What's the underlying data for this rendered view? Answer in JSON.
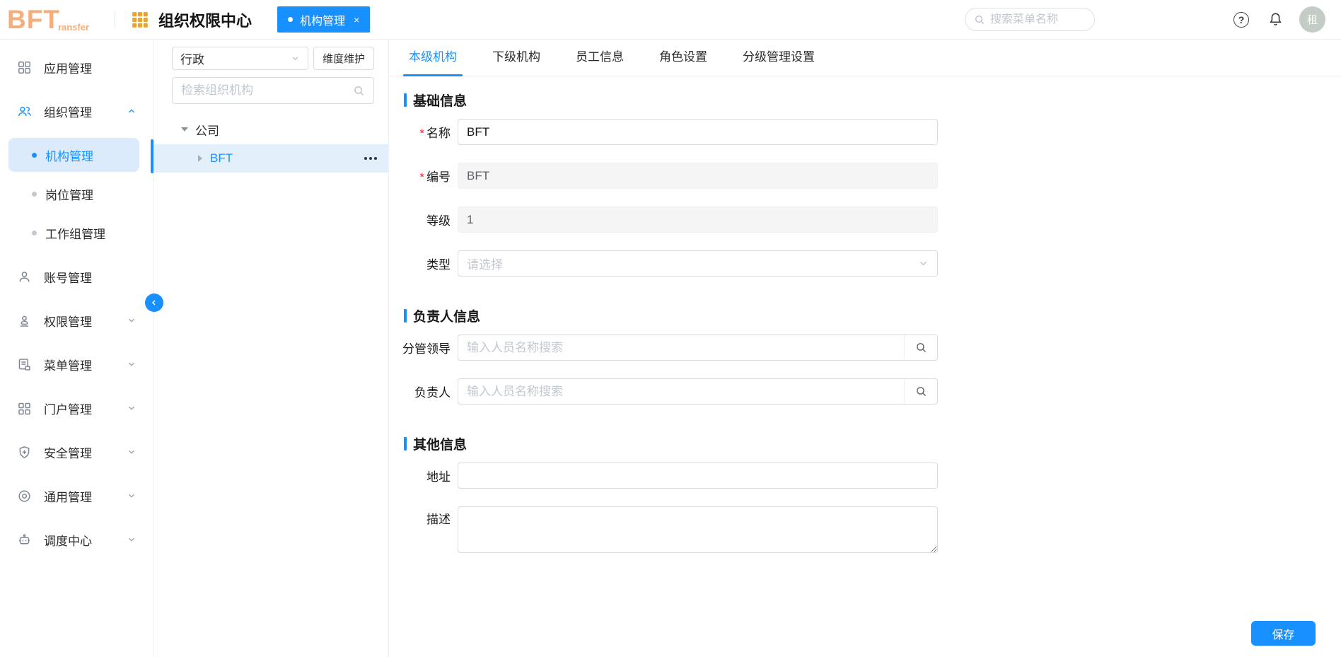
{
  "header": {
    "logo_main": "BFT",
    "logo_sub": "ransfer",
    "app_title": "组织权限中心",
    "chip": {
      "label": "机构管理",
      "close": "×"
    },
    "search_placeholder": "搜索菜单名称",
    "avatar_text": "租"
  },
  "sidebar": {
    "items": [
      {
        "label": "应用管理",
        "icon": "apps-icon"
      },
      {
        "label": "组织管理",
        "icon": "team-icon",
        "expanded": true,
        "children": [
          {
            "label": "机构管理",
            "active": true
          },
          {
            "label": "岗位管理"
          },
          {
            "label": "工作组管理"
          }
        ]
      },
      {
        "label": "账号管理",
        "icon": "user-icon"
      },
      {
        "label": "权限管理",
        "icon": "permission-icon"
      },
      {
        "label": "菜单管理",
        "icon": "menu-doc-icon"
      },
      {
        "label": "门户管理",
        "icon": "portal-icon"
      },
      {
        "label": "安全管理",
        "icon": "shield-icon"
      },
      {
        "label": "通用管理",
        "icon": "general-icon"
      },
      {
        "label": "调度中心",
        "icon": "robot-icon"
      }
    ]
  },
  "tree_panel": {
    "dimension_value": "行政",
    "maintain_button": "维度维护",
    "search_placeholder": "检索组织机构",
    "root_node": "公司",
    "child_node": "BFT"
  },
  "main": {
    "tabs": [
      {
        "label": "本级机构",
        "active": true
      },
      {
        "label": "下级机构"
      },
      {
        "label": "员工信息"
      },
      {
        "label": "角色设置"
      },
      {
        "label": "分级管理设置"
      }
    ],
    "required_mark": "*",
    "sections": {
      "basic": {
        "title": "基础信息"
      },
      "leader": {
        "title": "负责人信息"
      },
      "other": {
        "title": "其他信息"
      }
    },
    "form": {
      "name": {
        "label": "名称",
        "value": "BFT"
      },
      "code": {
        "label": "编号",
        "value": "BFT"
      },
      "level": {
        "label": "等级",
        "value": "1"
      },
      "type": {
        "label": "类型",
        "placeholder": "请选择"
      },
      "leader": {
        "label": "分管领导",
        "placeholder": "输入人员名称搜索",
        "value": ""
      },
      "manager": {
        "label": "负责人",
        "placeholder": "输入人员名称搜索",
        "value": ""
      },
      "address": {
        "label": "地址",
        "value": ""
      },
      "description": {
        "label": "描述",
        "value": ""
      }
    },
    "save_label": "保存"
  },
  "colors": {
    "primary": "#1890ff",
    "logo_orange": "#f4ae7c",
    "grid_icon_orange": "#f0a12c",
    "active_submenu_bg": "#dcebfb",
    "tree_selected_bg": "#e3f0fc",
    "avatar_bg": "#c3ccc5",
    "required_red": "#f5222d"
  }
}
